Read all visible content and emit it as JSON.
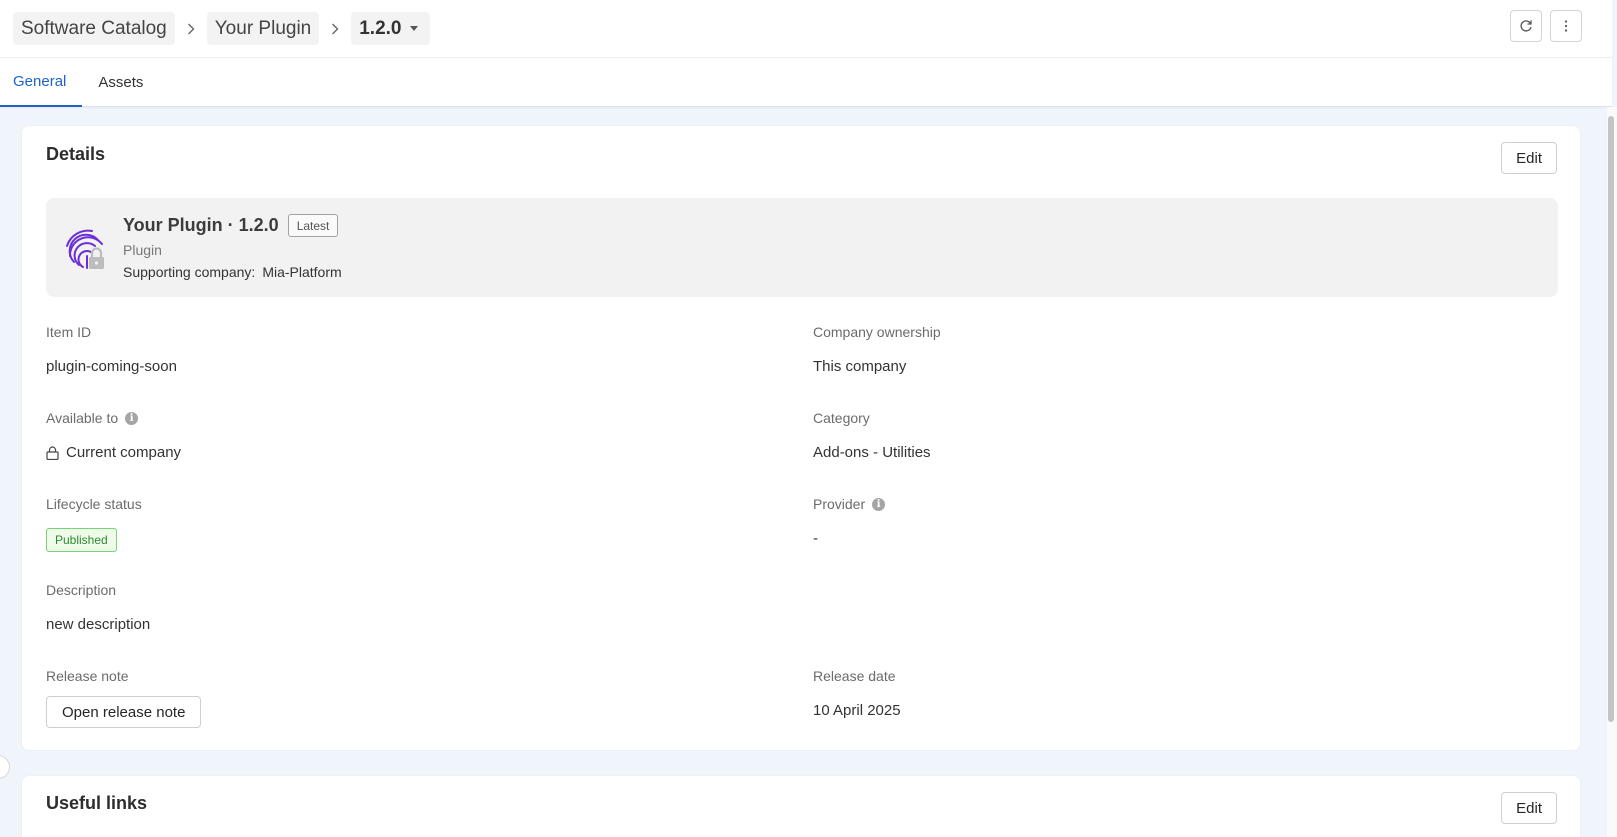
{
  "breadcrumb": {
    "items": [
      "Software Catalog",
      "Your Plugin",
      "1.2.0"
    ]
  },
  "header": {
    "refresh_icon": "refresh-icon",
    "more_icon": "more-vertical-icon"
  },
  "tabs": [
    {
      "label": "General",
      "active": true
    },
    {
      "label": "Assets",
      "active": false
    }
  ],
  "details": {
    "title": "Details",
    "edit_label": "Edit",
    "summary": {
      "name": "Your Plugin · 1.2.0",
      "latest_badge": "Latest",
      "type": "Plugin",
      "supporting_company_label": "Supporting company:",
      "supporting_company": "Mia-Platform",
      "icon": "fingerprint-lock-icon"
    },
    "fields": {
      "item_id_label": "Item ID",
      "item_id": "plugin-coming-soon",
      "company_ownership_label": "Company ownership",
      "company_ownership": "This company",
      "available_to_label": "Available to",
      "available_to": "Current company",
      "category_label": "Category",
      "category": "Add-ons - Utilities",
      "lifecycle_status_label": "Lifecycle status",
      "lifecycle_status": "Published",
      "provider_label": "Provider",
      "provider": "-",
      "description_label": "Description",
      "description": "new description",
      "release_note_label": "Release note",
      "release_note_button": "Open release note",
      "release_date_label": "Release date",
      "release_date": "10 April 2025"
    },
    "colors": {
      "accent": "#1d63c9",
      "published_bg": "#eefbe9",
      "published_border": "#79d179",
      "published_text": "#2f8a2f",
      "icon_purple": "#6a2fd6"
    }
  },
  "useful_links": {
    "title": "Useful links",
    "edit_label": "Edit"
  }
}
